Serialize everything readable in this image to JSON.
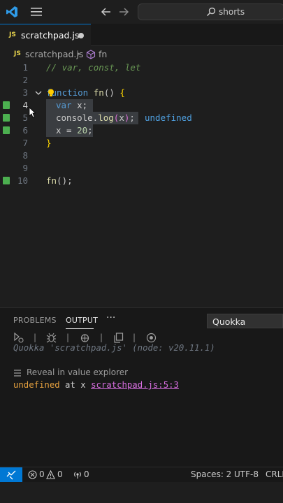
{
  "titlebar": {
    "command_center_text": "shorts",
    "icons": [
      "vscode-logo-icon",
      "menu-icon",
      "arrow-left-icon",
      "arrow-right-icon",
      "search-icon"
    ]
  },
  "tab": {
    "badge": "JS",
    "label": "scratchpad.js"
  },
  "breadcrumb": {
    "badge": "JS",
    "file": "scratchpad.js",
    "separator": "›",
    "symbol": "fn"
  },
  "editor": {
    "lines": [
      {
        "n": "1",
        "text": "// var, const, let"
      },
      {
        "n": "2",
        "text": ""
      },
      {
        "n": "3",
        "text": "function fn() {"
      },
      {
        "n": "4",
        "text": "var x;"
      },
      {
        "n": "5",
        "text": "console.log(x);",
        "inline_value": "undefined"
      },
      {
        "n": "6",
        "text": "x = 20;"
      },
      {
        "n": "7",
        "text": "}"
      },
      {
        "n": "8",
        "text": ""
      },
      {
        "n": "9",
        "text": ""
      },
      {
        "n": "10",
        "text": "fn();"
      }
    ],
    "colors": {
      "comment": "#6a9955",
      "keyword": "#569cd6",
      "function": "#dcdcaa",
      "number": "#b5cea8",
      "inline_value": "#4fa0e0",
      "coverage": "#4caf50"
    }
  },
  "panel": {
    "tabs": {
      "problems": "PROBLEMS",
      "output": "OUTPUT",
      "more": "···"
    },
    "channel": "Quokka",
    "toolbar_icons": [
      "run-icon",
      "debug-icon",
      "bug-icon",
      "copy-icon",
      "stop-icon"
    ],
    "separator": "|",
    "header_line": "Quokka 'scratchpad.js' (node: v20.11.1)",
    "reveal_label": "Reveal in value explorer",
    "result": {
      "value": "undefined",
      "at": " at x ",
      "link": "scratchpad.js:5:3"
    }
  },
  "statusbar": {
    "errors": "0",
    "warnings": "0",
    "ports": "0",
    "spaces": "Spaces: 2",
    "encoding": "UTF-8",
    "eol": "CRLF"
  }
}
